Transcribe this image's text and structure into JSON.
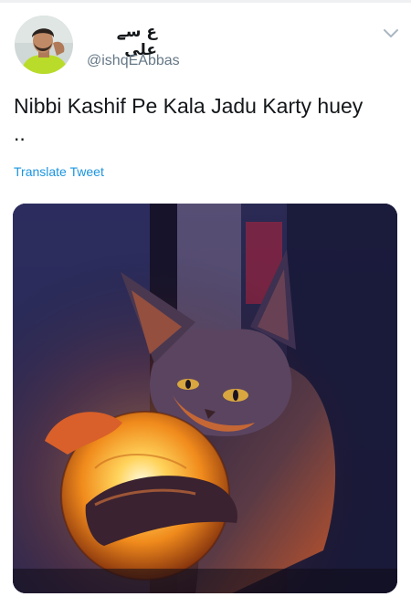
{
  "tweet": {
    "display_name": "ع سے علی",
    "handle": "@ishqEAbbas",
    "text": "Nibbi Kashif Pe Kala Jadu Karty huey ..",
    "translate_label": "Translate Tweet"
  },
  "icons": {
    "menu": "chevron-down-icon"
  },
  "colors": {
    "link": "#1b95e0",
    "text": "#14171a",
    "secondary": "#657786"
  }
}
